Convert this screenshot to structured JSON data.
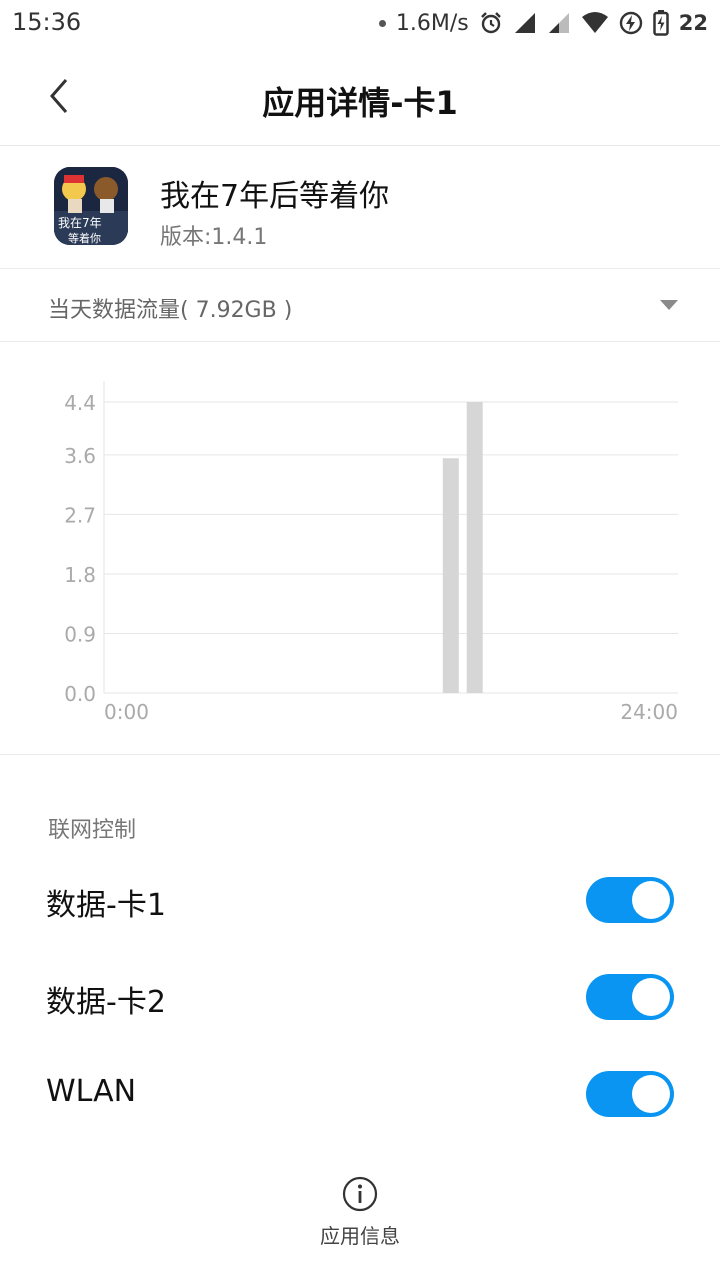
{
  "status_bar": {
    "time": "15:36",
    "speed": "1.6M/s",
    "battery": "22",
    "icons": [
      "notification-dot-icon",
      "alarm-icon",
      "signal-icon",
      "signal-weak-icon",
      "wifi-icon",
      "data-saver-icon",
      "battery-charging-icon"
    ]
  },
  "header": {
    "title": "应用详情-卡1",
    "back_icon": "chevron-left-icon"
  },
  "app": {
    "name": "我在7年后等着你",
    "version": "版本:1.4.1",
    "icon_text": [
      "我在7年",
      "等着你"
    ]
  },
  "usage": {
    "label": "当天数据流量( 7.92GB )",
    "caret_icon": "caret-down-icon"
  },
  "chart_data": {
    "type": "bar",
    "y_ticks": [
      "0.0",
      "0.9",
      "1.8",
      "2.7",
      "3.6",
      "4.4"
    ],
    "ylim": [
      0,
      4.4
    ],
    "x_start_label": "0:00",
    "x_end_label": "24:00",
    "xlim": [
      0,
      24
    ],
    "bars": [
      {
        "x": 14.5,
        "value": 3.55
      },
      {
        "x": 15.5,
        "value": 4.4
      }
    ],
    "bar_color": "#d6d6d6",
    "grid": true
  },
  "network_control": {
    "title": "联网控制",
    "items": [
      {
        "label": "数据-卡1",
        "enabled": true
      },
      {
        "label": "数据-卡2",
        "enabled": true
      },
      {
        "label": "WLAN",
        "enabled": true
      }
    ],
    "toggle_color": "#0a95f2"
  },
  "bottom": {
    "label": "应用信息",
    "icon": "info-icon"
  }
}
